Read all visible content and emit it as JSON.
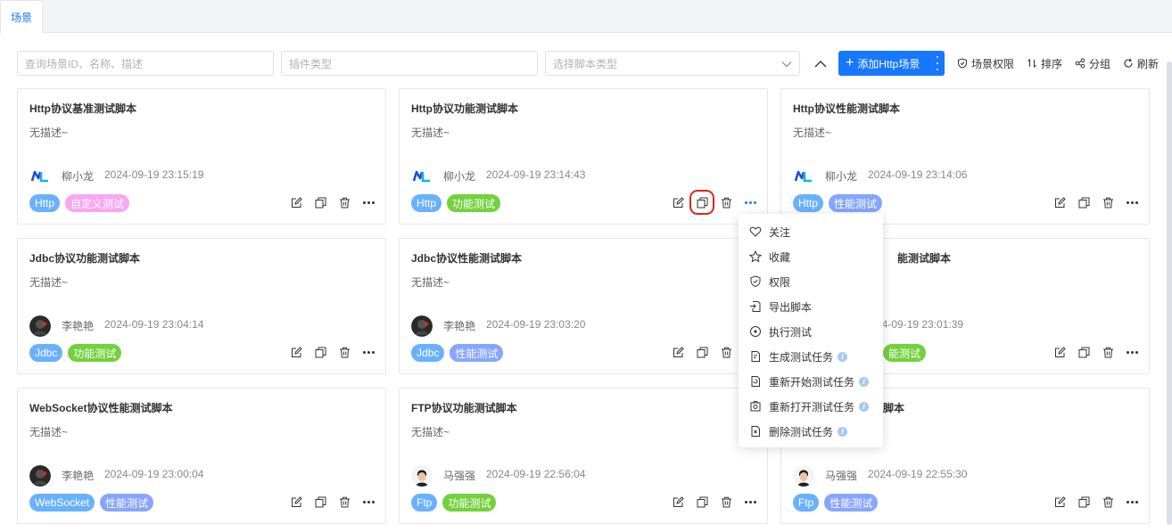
{
  "tabs": [
    {
      "label": "场景"
    }
  ],
  "filters": {
    "search_placeholder": "查询场景ID、名称、描述",
    "plugin_placeholder": "插件类型",
    "script_type_placeholder": "选择脚本类型"
  },
  "toolbar": {
    "add_label": "添加Http场景",
    "permission_label": "场景权限",
    "sort_label": "排序",
    "group_label": "分组",
    "refresh_label": "刷新"
  },
  "colors": {
    "primary": "#1677ff",
    "tag_protocol": "#69b1ff",
    "tag_custom": "#f7a8f0",
    "tag_function": "#73d13d",
    "tag_perf": "#85a5ff",
    "highlight": "#e0251a"
  },
  "cards": [
    {
      "title": "Http协议基准测试脚本",
      "desc": "无描述~",
      "author": "柳小龙",
      "date": "2024-09-19 23:15:19",
      "avatar": "nl-logo",
      "tags": [
        {
          "label": "Http",
          "kind": "protocol"
        },
        {
          "label": "自定义测试",
          "kind": "custom"
        }
      ]
    },
    {
      "title": "Http协议功能测试脚本",
      "desc": "无描述~",
      "author": "柳小龙",
      "date": "2024-09-19 23:14:43",
      "avatar": "nl-logo",
      "tags": [
        {
          "label": "Http",
          "kind": "protocol"
        },
        {
          "label": "功能测试",
          "kind": "function"
        }
      ]
    },
    {
      "title": "Http协议性能测试脚本",
      "desc": "无描述~",
      "author": "柳小龙",
      "date": "2024-09-19 23:14:06",
      "avatar": "nl-logo",
      "tags": [
        {
          "label": "Http",
          "kind": "protocol"
        },
        {
          "label": "性能测试",
          "kind": "perf"
        }
      ]
    },
    {
      "title": "Jdbc协议功能测试脚本",
      "desc": "无描述~",
      "author": "李艳艳",
      "date": "2024-09-19 23:04:14",
      "avatar": "dark-avatar",
      "tags": [
        {
          "label": "Jdbc",
          "kind": "protocol"
        },
        {
          "label": "功能测试",
          "kind": "function"
        }
      ]
    },
    {
      "title": "Jdbc协议性能测试脚本",
      "desc": "无描述~",
      "author": "李艳艳",
      "date": "2024-09-19 23:03:20",
      "avatar": "dark-avatar",
      "tags": [
        {
          "label": "Jdbc",
          "kind": "protocol"
        },
        {
          "label": "性能测试",
          "kind": "perf"
        }
      ]
    },
    {
      "title": "能测试脚本",
      "desc": "",
      "author": "",
      "date": "24-09-19 23:01:39",
      "avatar": "",
      "tags": [
        {
          "label": "能测试",
          "kind": "function"
        }
      ]
    },
    {
      "title": "WebSocket协议性能测试脚本",
      "desc": "无描述~",
      "author": "李艳艳",
      "date": "2024-09-19 23:00:04",
      "avatar": "dark-avatar",
      "tags": [
        {
          "label": "WebSocket",
          "kind": "protocol"
        },
        {
          "label": "性能测试",
          "kind": "perf"
        }
      ]
    },
    {
      "title": "FTP协议功能测试脚本",
      "desc": "无描述~",
      "author": "马强强",
      "date": "2024-09-19 22:56:04",
      "avatar": "man-avatar",
      "tags": [
        {
          "label": "Ftp",
          "kind": "protocol"
        },
        {
          "label": "功能测试",
          "kind": "function"
        }
      ]
    },
    {
      "title": "脚本",
      "desc": "",
      "author": "马强强",
      "date": "2024-09-19 22:55:30",
      "avatar": "man-avatar",
      "tags": [
        {
          "label": "Ftp",
          "kind": "protocol"
        },
        {
          "label": "性能测试",
          "kind": "perf"
        }
      ]
    }
  ],
  "menu": {
    "items": [
      {
        "label": "关注",
        "icon": "heart-icon",
        "info": false
      },
      {
        "label": "收藏",
        "icon": "star-icon",
        "info": false
      },
      {
        "label": "权限",
        "icon": "shield-icon",
        "info": false
      },
      {
        "label": "导出脚本",
        "icon": "export-icon",
        "info": false
      },
      {
        "label": "执行测试",
        "icon": "execute-icon",
        "info": false
      },
      {
        "label": "生成测试任务",
        "icon": "generate-task-icon",
        "info": true
      },
      {
        "label": "重新开始测试任务",
        "icon": "restart-task-icon",
        "info": true
      },
      {
        "label": "重新打开测试任务",
        "icon": "reopen-task-icon",
        "info": true
      },
      {
        "label": "删除测试任务",
        "icon": "delete-task-icon",
        "info": true
      }
    ]
  }
}
